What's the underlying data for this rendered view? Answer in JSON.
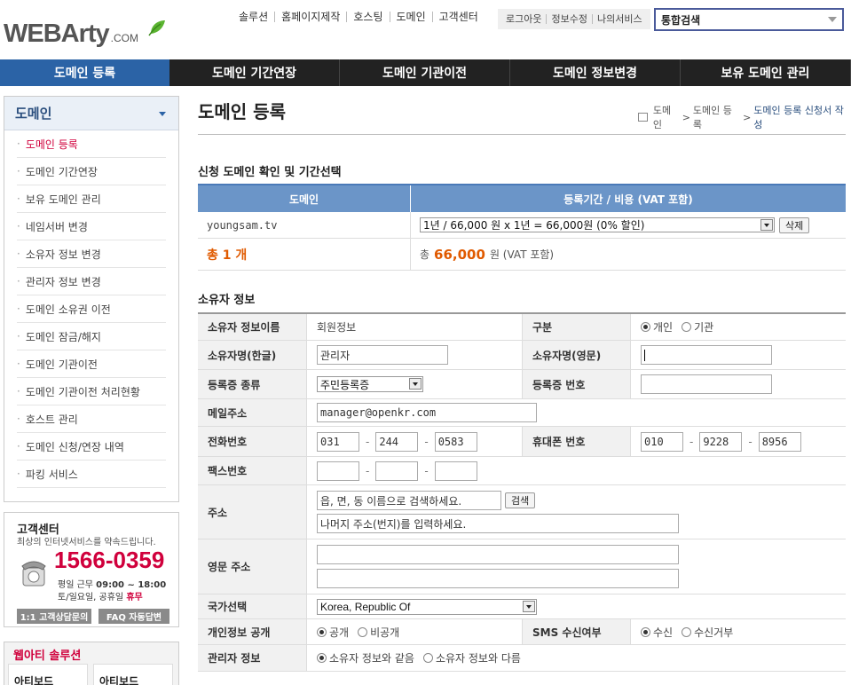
{
  "brand": {
    "name": "WEBArty",
    "suffix": ".COM"
  },
  "topnav": [
    "솔루션",
    "홈페이지제작",
    "호스팅",
    "도메인",
    "고객센터"
  ],
  "account": [
    "로그아웃",
    "정보수정",
    "나의서비스"
  ],
  "search": {
    "selected": "통합검색"
  },
  "mainnav": [
    "도메인 등록",
    "도메인 기간연장",
    "도메인 기관이전",
    "도메인 정보변경",
    "보유 도메인 관리"
  ],
  "sidebar": {
    "title": "도메인",
    "items": [
      "도메인 등록",
      "도메인 기간연장",
      "보유 도메인 관리",
      "네임서버 변경",
      "소유자 정보 변경",
      "관리자 정보 변경",
      "도메인 소유권 이전",
      "도메인 잠금/해지",
      "도메인 기관이전",
      "도메인 기관이전 처리현황",
      "호스트 관리",
      "도메인 신청/연장 내역",
      "파킹 서비스"
    ]
  },
  "cs": {
    "title": "고객센터",
    "subtitle": "최상의 인터넷서비스를 약속드립니다.",
    "phone": "1566-0359",
    "hours_label": "평일 근무",
    "hours": "09:00 ~ 18:00",
    "holiday_label": "토/일요일, 공휴일",
    "holiday": "휴무",
    "btn1": "1:1 고객상담문의",
    "btn2": "FAQ 자동답변"
  },
  "solution": {
    "title": "웹아티 솔루션",
    "b1": "아티보드",
    "b2": "아티보드"
  },
  "page": {
    "title": "도메인 등록",
    "crumb": [
      "도메인",
      "도메인 등록"
    ],
    "crumb_current": "도메인 등록 신청서 작성",
    "section1": "신청 도메인 확인 및 기간선택",
    "section2": "소유자 정보"
  },
  "domain_table": {
    "col1": "도메인",
    "col2": "등록기간 / 비용 (VAT 포함)",
    "domain": "youngsam.tv",
    "period": "1년 / 66,000 원 x 1년 = 66,000원 (0% 할인)",
    "delete": "삭제",
    "total_label": "총 1 개",
    "total_prefix": "총",
    "total_amount": "66,000",
    "total_suffix": "원 (VAT 포함)"
  },
  "owner": {
    "info_name_label": "소유자 정보이름",
    "info_name_value": "회원정보",
    "type_label": "구분",
    "type_opt1": "개인",
    "type_opt2": "기관",
    "name_ko_label": "소유자명(한글)",
    "name_ko_value": "관리자",
    "name_en_label": "소유자명(영문)",
    "cert_type_label": "등록증 종류",
    "cert_type_value": "주민등록증",
    "cert_no_label": "등록증 번호",
    "email_label": "메일주소",
    "email_value": "manager@openkr.com",
    "phone_label": "전화번호",
    "phone": [
      "031",
      "244",
      "0583"
    ],
    "mobile_label": "휴대폰 번호",
    "mobile": [
      "010",
      "9228",
      "8956"
    ],
    "fax_label": "팩스번호",
    "addr_label": "주소",
    "addr_search_value": "읍, 면, 동 이름으로 검색하세요.",
    "addr_search_btn": "검색",
    "addr_detail_value": "나머지 주소(번지)를 입력하세요.",
    "en_addr_label": "영문 주소",
    "country_label": "국가선택",
    "country_value": "Korea, Republic Of",
    "privacy_label": "개인정보 공개",
    "privacy_opt1": "공개",
    "privacy_opt2": "비공개",
    "sms_label": "SMS 수신여부",
    "sms_opt1": "수신",
    "sms_opt2": "수신거부",
    "admin_label": "관리자 정보",
    "admin_opt1": "소유자 정보와 같음",
    "admin_opt2": "소유자 정보와 다름"
  }
}
